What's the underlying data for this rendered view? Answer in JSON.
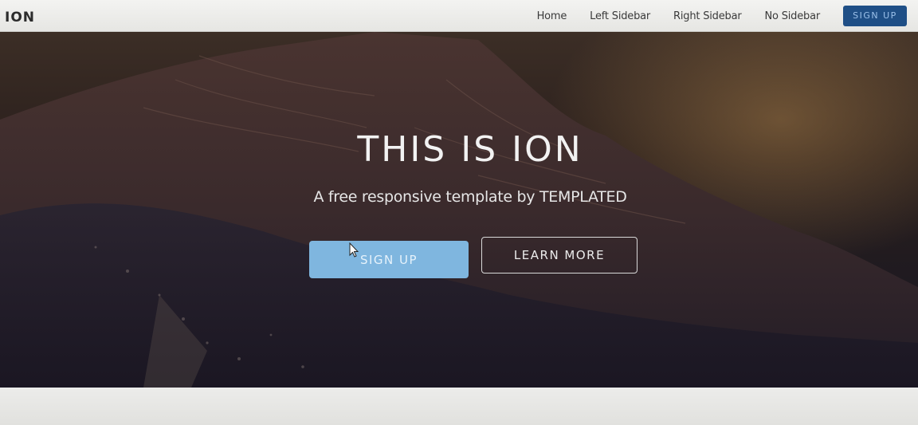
{
  "header": {
    "logo": "ION",
    "nav": [
      "Home",
      "Left Sidebar",
      "Right Sidebar",
      "No Sidebar"
    ],
    "signup": "SIGN UP"
  },
  "hero": {
    "title": "THIS IS ION",
    "subtitle": "A free responsive template by TEMPLATED",
    "primary_button": "SIGN UP",
    "secondary_button": "LEARN MORE"
  },
  "colors": {
    "header_bg": "#eeeeeb",
    "nav_button": "#1f4f86",
    "primary_button": "#7fb6df",
    "hero_dark": "#1f1a20"
  },
  "icons": [
    "mouse-cursor-icon"
  ]
}
